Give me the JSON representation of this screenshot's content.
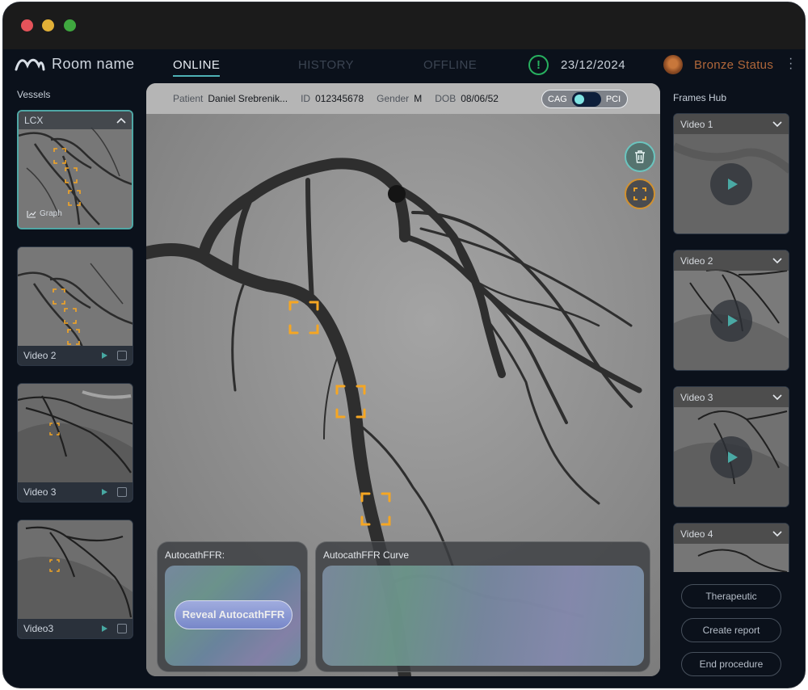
{
  "app": {
    "room_name": "Room name",
    "tabs": [
      {
        "label": "ONLINE",
        "active": true
      },
      {
        "label": "HISTORY",
        "active": false
      },
      {
        "label": "OFFLINE",
        "active": false
      }
    ],
    "date": "23/12/2024",
    "status_label": "Bronze Status",
    "alert_glyph": "!"
  },
  "vessels": {
    "title": "Vessels",
    "selected": {
      "label": "LCX",
      "graph_label": "Graph"
    },
    "items": [
      {
        "label": "Video 2"
      },
      {
        "label": "Video 3"
      },
      {
        "label": "Video3"
      }
    ]
  },
  "patient": {
    "patient_key": "Patient",
    "name": "Daniel Srebrenik...",
    "id_key": "ID",
    "id": "012345678",
    "gender_key": "Gender",
    "gender": "M",
    "dob_key": "DOB",
    "dob": "08/06/52"
  },
  "mode_toggle": {
    "left": "CAG",
    "right": "PCI",
    "selected": "PCI"
  },
  "ffr": {
    "panel_title": "AutocathFFR:",
    "reveal_label": "Reveal AutocathFFR",
    "curve_title": "AutocathFFR Curve"
  },
  "frames_hub": {
    "title": "Frames Hub",
    "items": [
      {
        "label": "Video 1"
      },
      {
        "label": "Video 2"
      },
      {
        "label": "Video 3"
      },
      {
        "label": "Video 4"
      }
    ]
  },
  "actions": {
    "therapeutic": "Therapeutic",
    "create_report": "Create report",
    "end_procedure": "End procedure"
  },
  "colors": {
    "accent": "#4fb1b5",
    "marker": "#f5a623",
    "status": "#b0673a",
    "alert": "#27b05f",
    "background": "#0b111b"
  }
}
